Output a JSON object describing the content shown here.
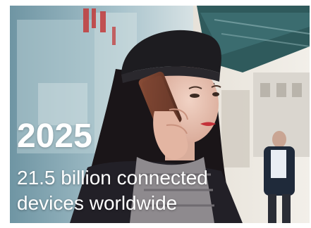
{
  "banner": {
    "year": "2025",
    "caption_line1": "21.5 billion connected",
    "caption_line2": "devices worldwide",
    "photo": "woman-on-phone-photo"
  },
  "colors": {
    "text": "#ffffff",
    "sky": "#9db9c3",
    "awning": "#2f5a5c",
    "hat": "#1d1c20",
    "phone": "#6b3a2a"
  }
}
